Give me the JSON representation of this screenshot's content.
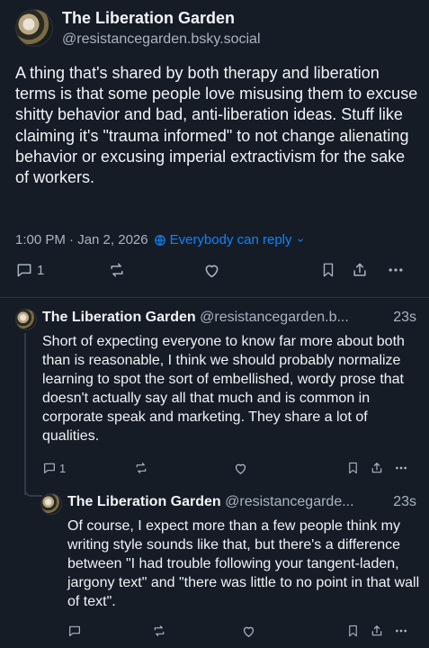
{
  "main_post": {
    "display_name": "The Liberation Garden",
    "handle": "@resistancegarden.bsky.social",
    "text": "A thing that's shared by both therapy and liberation terms is that some people love misusing them to excuse shitty behavior and bad, anti-liberation ideas. Stuff like claiming it's \"trauma informed\" to not change alienating behavior or excusing imperial extractivism for the sake of workers.",
    "timestamp": "1:00 PM · Jan 2, 2026",
    "reply_setting": "Everybody can reply",
    "reply_count": "1"
  },
  "reply1": {
    "display_name": "The Liberation Garden",
    "handle": "@resistancegarden.b...",
    "age": "23s",
    "text": "Short of expecting everyone to know far more about both than is reasonable, I think we should probably normalize learning to spot the sort of embellished, wordy prose that doesn't actually say all that much and is common in corporate speak and marketing. They share a lot of qualities.",
    "reply_count": "1"
  },
  "reply2": {
    "display_name": "The Liberation Garden",
    "handle": "@resistancegarde...",
    "age": "23s",
    "text": "Of course, I expect more than a few people think my writing style sounds like that, but there's a difference between \"I had trouble following your tangent-laden, jargony text\" and \"there was little to no point in that wall of text\"."
  },
  "colors": {
    "background": "#151c26",
    "accent": "#1083fe",
    "muted": "#aab4c2"
  }
}
